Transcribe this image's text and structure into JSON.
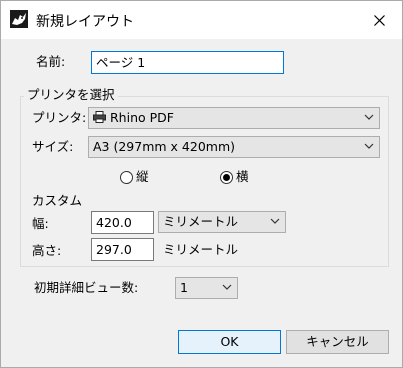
{
  "window": {
    "title": "新規レイアウト"
  },
  "name_field": {
    "label": "名前:",
    "value": "ページ 1"
  },
  "printer_group": {
    "title": "プリンタを選択",
    "printer": {
      "label": "プリンタ:",
      "value": "Rhino PDF"
    },
    "size": {
      "label": "サイズ:",
      "value": "A3 (297mm x 420mm)"
    },
    "orientation": {
      "portrait_label": "縦",
      "landscape_label": "横",
      "selected": "landscape"
    },
    "custom": {
      "title": "カスタム",
      "width_label": "幅:",
      "width_value": "420.0",
      "height_label": "高さ:",
      "height_value": "297.0",
      "unit_selected": "ミリメートル",
      "height_unit": "ミリメートル"
    }
  },
  "detail_views": {
    "label": "初期詳細ビュー数:",
    "value": "1"
  },
  "buttons": {
    "ok": "OK",
    "cancel": "キャンセル"
  },
  "colors": {
    "accent": "#0078d7",
    "background": "#f0f0f0"
  }
}
